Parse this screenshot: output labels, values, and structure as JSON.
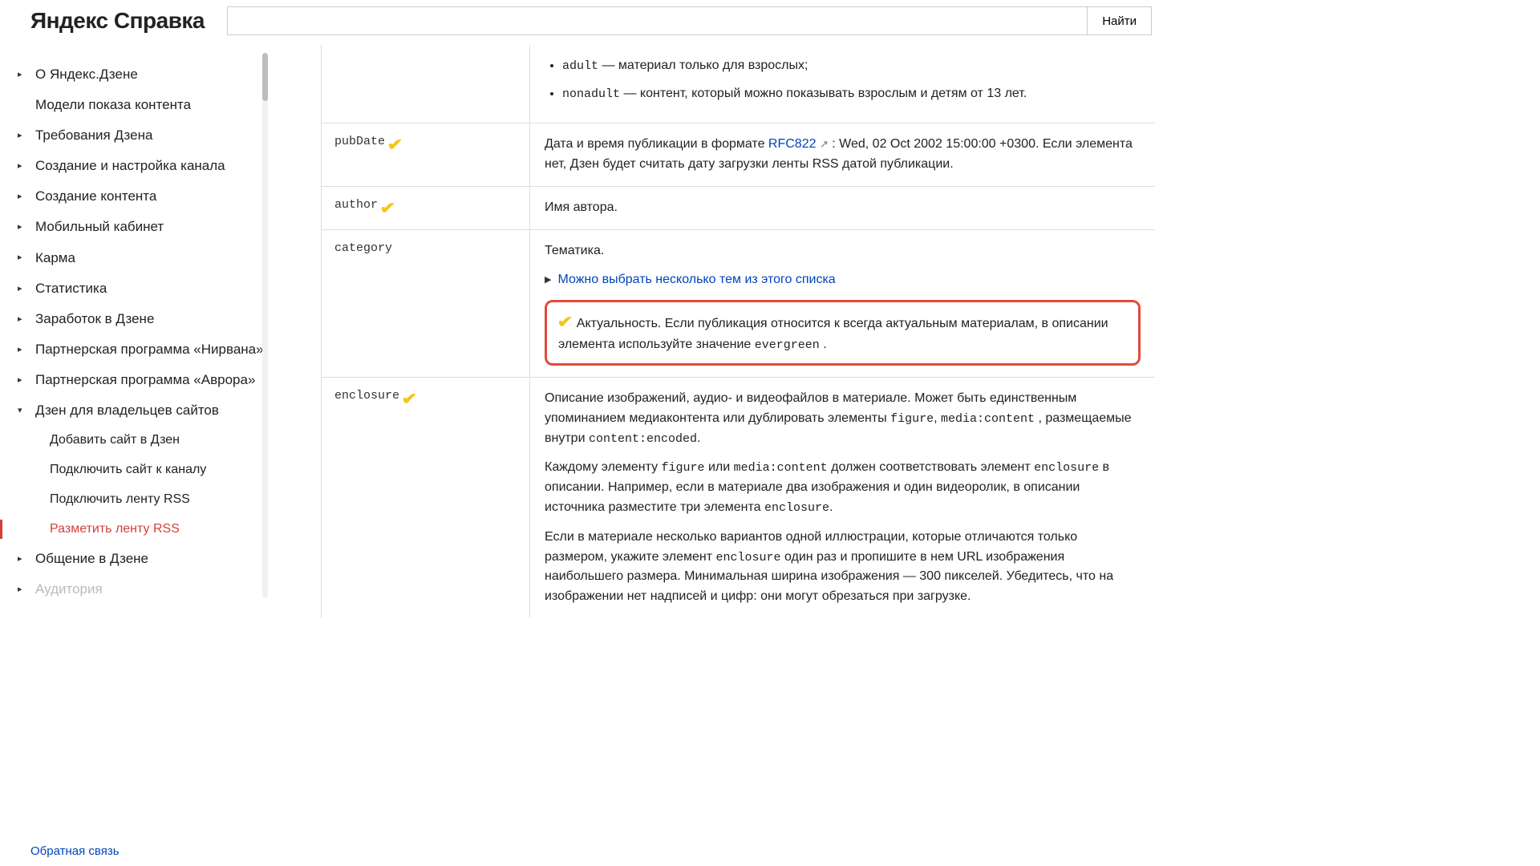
{
  "header": {
    "logo": "Яндекс Справка",
    "search_btn": "Найти"
  },
  "sidebar": {
    "items": [
      {
        "label": "О Яндекс.Дзене",
        "caret": true
      },
      {
        "label": "Модели показа контента",
        "caret": false
      },
      {
        "label": "Требования Дзена",
        "caret": true
      },
      {
        "label": "Создание и настройка канала",
        "caret": true
      },
      {
        "label": "Создание контента",
        "caret": true
      },
      {
        "label": "Мобильный кабинет",
        "caret": true
      },
      {
        "label": "Карма",
        "caret": true
      },
      {
        "label": "Статистика",
        "caret": true
      },
      {
        "label": "Заработок в Дзене",
        "caret": true
      },
      {
        "label": "Партнерская программа «Нирвана»",
        "caret": true
      },
      {
        "label": "Партнерская программа «Аврора»",
        "caret": true
      },
      {
        "label": "Дзен для владельцев сайтов",
        "caret": true,
        "down": true
      },
      {
        "label": "Добавить сайт в Дзен",
        "sub": true
      },
      {
        "label": "Подключить сайт к каналу",
        "sub": true
      },
      {
        "label": "Подключить ленту RSS",
        "sub": true
      },
      {
        "label": "Разметить ленту RSS",
        "sub": true,
        "active": true
      },
      {
        "label": "Общение в Дзене",
        "caret": true
      },
      {
        "label": "Аудитория",
        "caret": true,
        "faded": true
      }
    ]
  },
  "rows": {
    "row0": {
      "bullets": [
        {
          "code": "adult",
          "text": " — материал только для взрослых;"
        },
        {
          "code": "nonadult",
          "text": " — контент, который можно показывать взрослым и детям от 13 лет."
        }
      ]
    },
    "pubdate": {
      "key": "pubDate",
      "text1": "Дата и время публикации в формате ",
      "link": "RFC822",
      "text2": " : Wed, 02 Oct 2002 15:00:00 +0300. Если элемента нет, Дзен будет считать дату загрузки ленты RSS датой публикации."
    },
    "author": {
      "key": "author",
      "text": "Имя автора."
    },
    "category": {
      "key": "category",
      "title": "Тематика.",
      "expand": "Можно выбрать несколько тем из этого списка",
      "highlight_pre": "Актуальность. Если публикация относится к всегда актуальным материалам, в описании элемента используйте значение ",
      "highlight_code": "evergreen",
      "highlight_post": " ."
    },
    "enclosure": {
      "key": "enclosure",
      "p1_a": "Описание изображений, аудио- и видеофайлов в материале. Может быть единственным упоминанием медиаконтента или дублировать элементы ",
      "p1_c1": "figure",
      "p1_b": ", ",
      "p1_c2": "media:content",
      "p1_c": " , размещаемые внутри ",
      "p1_c3": "content:encoded",
      "p1_d": ".",
      "p2_a": "Каждому элементу ",
      "p2_c1": "figure",
      "p2_b": " или ",
      "p2_c2": "media:content",
      "p2_c": " должен соответствовать элемент ",
      "p2_c3": "enclosure",
      "p2_d": " в описании. Например, если в материале два изображения и один видеоролик, в описании источника разместите три элемента ",
      "p2_c4": "enclosure",
      "p2_e": ".",
      "p3_a": "Если в материале несколько вариантов одной иллюстрации, которые отличаются только размером, укажите элемент ",
      "p3_c1": "enclosure",
      "p3_b": " один раз и пропишите в нем URL изображения наибольшего размера. Минимальная ширина изображения — 300 пикселей. Убедитесь, что на изображении нет надписей и цифр: они могут обрезаться при загрузке."
    }
  },
  "footer": {
    "feedback": "Обратная связь"
  }
}
